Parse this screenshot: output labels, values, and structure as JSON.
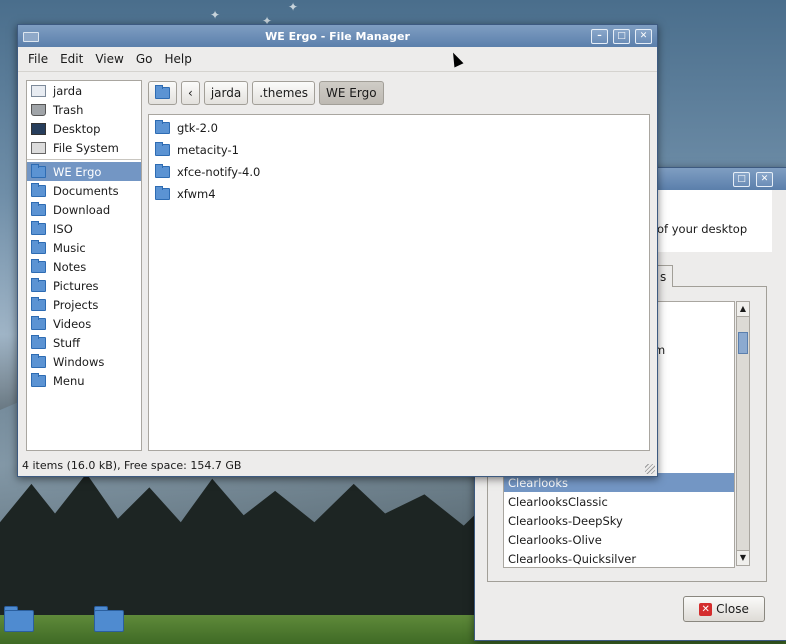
{
  "file_manager": {
    "title": "WE Ergo - File Manager",
    "menu": [
      "File",
      "Edit",
      "View",
      "Go",
      "Help"
    ],
    "sidebar_places": [
      {
        "label": "jarda",
        "icon": "home-icon"
      },
      {
        "label": "Trash",
        "icon": "trash-icon"
      },
      {
        "label": "Desktop",
        "icon": "desktop-icon"
      },
      {
        "label": "File System",
        "icon": "drive-icon"
      }
    ],
    "sidebar_bookmarks": [
      "WE Ergo",
      "Documents",
      "Download",
      "ISO",
      "Music",
      "Notes",
      "Pictures",
      "Projects",
      "Videos",
      "Stuff",
      "Windows",
      "Menu"
    ],
    "selected_bookmark": "WE Ergo",
    "path": [
      "jarda",
      ".themes",
      "WE Ergo"
    ],
    "back_label": "‹",
    "files": [
      "gtk-2.0",
      "metacity-1",
      "xfce-notify-4.0",
      "xfwm4"
    ],
    "status": "4 items (16.0 kB), Free space: 154.7 GB"
  },
  "appearance": {
    "description_fragment": "of your desktop",
    "tab_fragment": "s",
    "partial_item": "m",
    "themes": [
      "Clearlooks",
      "ClearlooksClassic",
      "Clearlooks-DeepSky",
      "Clearlooks-Olive",
      "Clearlooks-Quicksilver"
    ],
    "selected_theme": "Clearlooks",
    "close_label": "Close"
  }
}
